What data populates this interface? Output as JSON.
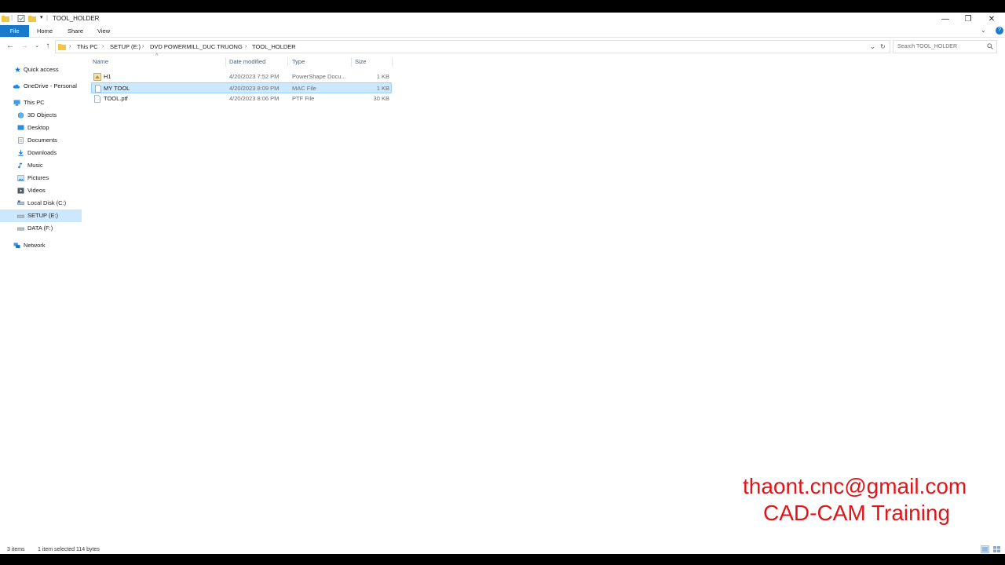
{
  "window": {
    "title": "TOOL_HOLDER",
    "controls": {
      "minimize": "—",
      "restore": "❐",
      "close": "✕"
    }
  },
  "ribbon": {
    "tabs": [
      "File",
      "Home",
      "Share",
      "View"
    ],
    "help": "?"
  },
  "address": {
    "crumbs": [
      "This PC",
      "SETUP (E:)",
      "DVD POWERMILL_DUC TRUONG",
      "TOOL_HOLDER"
    ]
  },
  "search": {
    "placeholder": "Search TOOL_HOLDER"
  },
  "nav": {
    "items": [
      {
        "label": "Quick access",
        "icon": "star-icon"
      },
      {
        "label": "OneDrive - Personal",
        "icon": "cloud-icon"
      },
      {
        "label": "This PC",
        "icon": "computer-icon"
      },
      {
        "label": "3D Objects",
        "icon": "cube-icon"
      },
      {
        "label": "Desktop",
        "icon": "desktop-icon"
      },
      {
        "label": "Documents",
        "icon": "document-icon"
      },
      {
        "label": "Downloads",
        "icon": "download-icon"
      },
      {
        "label": "Music",
        "icon": "music-icon"
      },
      {
        "label": "Pictures",
        "icon": "picture-icon"
      },
      {
        "label": "Videos",
        "icon": "video-icon"
      },
      {
        "label": "Local Disk (C:)",
        "icon": "drive-icon"
      },
      {
        "label": "SETUP (E:)",
        "icon": "drive-icon"
      },
      {
        "label": "DATA (F:)",
        "icon": "drive-icon"
      },
      {
        "label": "Network",
        "icon": "network-icon"
      }
    ]
  },
  "columns": {
    "name": "Name",
    "date": "Date modified",
    "type": "Type",
    "size": "Size"
  },
  "files": [
    {
      "name": "H1",
      "date": "4/20/2023 7:52 PM",
      "type": "PowerShape Docu...",
      "size": "1 KB",
      "selected": false
    },
    {
      "name": "MY TOOL",
      "date": "4/20/2023 8:09 PM",
      "type": "MAC File",
      "size": "1 KB",
      "selected": true
    },
    {
      "name": "TOOL.ptf",
      "date": "4/20/2023 8:06 PM",
      "type": "PTF File",
      "size": "30 KB",
      "selected": false
    }
  ],
  "status": {
    "count": "3 items",
    "selection": "1 item selected  114 bytes"
  },
  "watermark": {
    "email": "thaont.cnc@gmail.com",
    "tagline": "CAD-CAM Training"
  },
  "colors": {
    "accent": "#1979ca",
    "selection": "#cce8ff",
    "watermark": "#e0151a"
  }
}
